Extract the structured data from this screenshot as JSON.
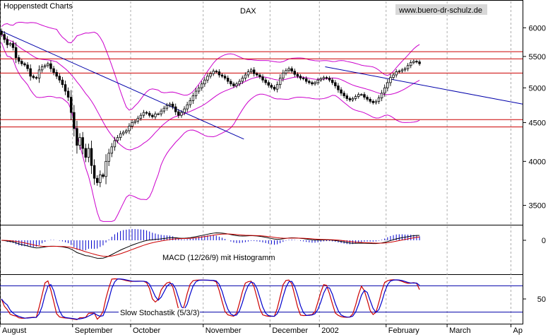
{
  "header": {
    "brand": "Hoppenstedt Charts",
    "symbol": "DAX",
    "website": "www.buero-dr-schulz.de"
  },
  "chart_data": [
    {
      "type": "candlestick",
      "title": "DAX",
      "y_scale": "log",
      "ylim": [
        3300,
        6500
      ],
      "y_ticks": [
        3500,
        4000,
        4500,
        5000,
        5500,
        6000
      ],
      "x_labels": [
        "August",
        "September",
        "October",
        "November",
        "December",
        "2002",
        "February",
        "March",
        "Ap"
      ],
      "x_range": [
        0,
        180
      ],
      "x_label_positions": [
        0,
        25,
        45,
        70,
        93,
        110,
        133,
        154,
        176
      ],
      "bars_per_week": 5,
      "closes": [
        5880,
        5790,
        5700,
        5720,
        5650,
        5480,
        5420,
        5380,
        5360,
        5300,
        5180,
        5160,
        5150,
        5280,
        5330,
        5350,
        5380,
        5300,
        5240,
        5180,
        5120,
        5050,
        4950,
        4860,
        4640,
        4420,
        4200,
        4300,
        4160,
        4050,
        4160,
        3950,
        3800,
        3750,
        3840,
        3820,
        4000,
        4100,
        4180,
        4260,
        4300,
        4350,
        4370,
        4390,
        4450,
        4500,
        4520,
        4560,
        4600,
        4640,
        4630,
        4600,
        4580,
        4620,
        4620,
        4660,
        4700,
        4740,
        4760,
        4720,
        4650,
        4600,
        4640,
        4690,
        4750,
        4810,
        4880,
        4950,
        5000,
        5060,
        5120,
        5180,
        5220,
        5260,
        5250,
        5200,
        5180,
        5150,
        5100,
        5060,
        5030,
        5060,
        5100,
        5150,
        5200,
        5250,
        5280,
        5220,
        5200,
        5170,
        5120,
        5080,
        5040,
        5010,
        4980,
        5050,
        5150,
        5230,
        5270,
        5300,
        5260,
        5210,
        5180,
        5150,
        5140,
        5100,
        5080,
        5060,
        5080,
        5120,
        5140,
        5160,
        5150,
        5120,
        5080,
        5030,
        4970,
        4920,
        4880,
        4840,
        4820,
        4840,
        4870,
        4900,
        4900,
        4860,
        4830,
        4800,
        4780,
        4800,
        4850,
        4920,
        5000,
        5080,
        5160,
        5200,
        5250,
        5260,
        5280,
        5300,
        5350,
        5400,
        5420,
        5410,
        5380
      ],
      "resistance_lines": [
        5580,
        5460,
        5230,
        4540,
        4440
      ],
      "trendlines": [
        {
          "from": {
            "x": 0,
            "y": 5950
          },
          "to": {
            "x": 84,
            "y": 4280
          }
        },
        {
          "from": {
            "x": 112,
            "y": 5330
          },
          "to": {
            "x": 180,
            "y": 4760
          }
        }
      ],
      "line_colors": {
        "candles": "#000000",
        "bands": "#cc00cc",
        "horizontal": "#cc0000",
        "trend": "#0000aa",
        "grid": "#888888"
      }
    },
    {
      "type": "line",
      "title": "MACD (12/26/9) mit Histogramm",
      "y_ticks": [
        0
      ],
      "series": [
        {
          "color": "#000000"
        },
        {
          "color": "#cc0000"
        },
        {
          "type": "histogram",
          "color": "#0000cc"
        }
      ]
    },
    {
      "type": "line",
      "title": "Slow Stochastik (5/3/3)",
      "y_ticks": [
        50
      ],
      "ylim": [
        0,
        100
      ],
      "reference_lines": [
        80,
        20
      ],
      "series": [
        {
          "color": "#0000cc"
        },
        {
          "color": "#cc0000"
        }
      ]
    }
  ]
}
